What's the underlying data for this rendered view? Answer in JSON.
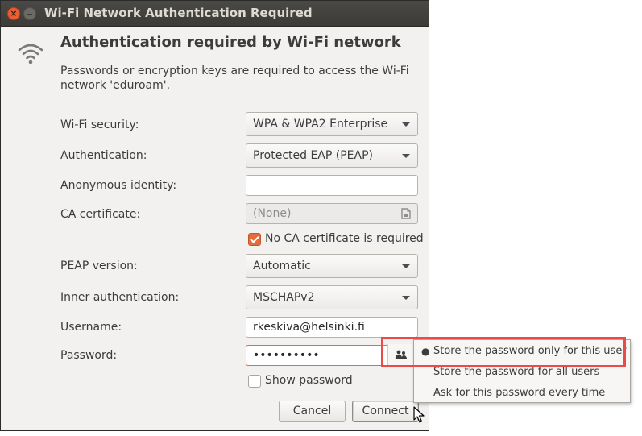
{
  "window": {
    "title": "Wi-Fi Network Authentication Required"
  },
  "dialog": {
    "icon": "wifi-icon",
    "heading": "Authentication required by Wi-Fi network",
    "description": "Passwords or encryption keys are required to access the Wi-Fi network 'eduroam'."
  },
  "form": {
    "wifi_security": {
      "label": "Wi-Fi security:",
      "value": "WPA & WPA2 Enterprise"
    },
    "authentication": {
      "label": "Authentication:",
      "value": "Protected EAP (PEAP)"
    },
    "anonymous_identity": {
      "label": "Anonymous identity:",
      "value": ""
    },
    "ca_certificate": {
      "label": "CA certificate:",
      "value": "(None)"
    },
    "no_ca_required": {
      "label": "No CA certificate is required",
      "checked": true
    },
    "peap_version": {
      "label": "PEAP version:",
      "value": "Automatic"
    },
    "inner_authentication": {
      "label": "Inner authentication:",
      "value": "MSCHAPv2"
    },
    "username": {
      "label": "Username:",
      "value": "rkeskiva@helsinki.fi"
    },
    "password": {
      "label": "Password:",
      "value": "••••••••••"
    },
    "show_password": {
      "label": "Show password",
      "checked": false
    }
  },
  "buttons": {
    "cancel": "Cancel",
    "connect": "Connect"
  },
  "password_storage_menu": {
    "items": [
      {
        "label": "Store the password only for this user",
        "selected": true
      },
      {
        "label": "Store the password for all users",
        "selected": false
      },
      {
        "label": "Ask for this password every time",
        "selected": false
      }
    ],
    "bullet": "●"
  },
  "colors": {
    "accent": "#e36c3e",
    "highlight_box": "#ea4a4a",
    "titlebar": "#3c3b37",
    "dialog_bg": "#f2f1f0"
  }
}
